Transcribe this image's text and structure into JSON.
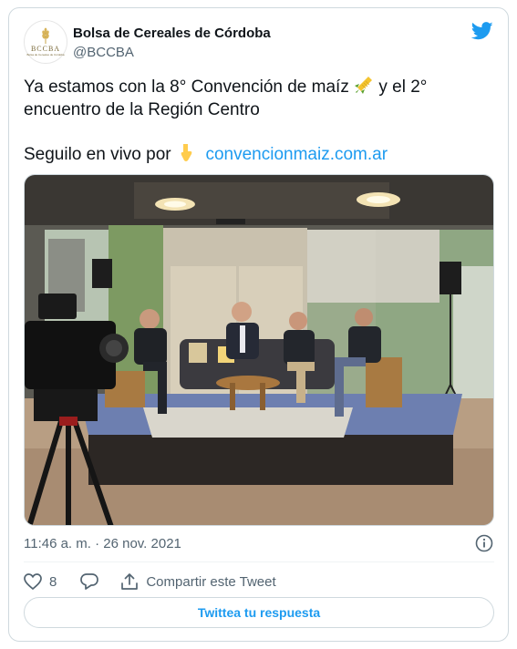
{
  "account": {
    "name": "Bolsa de Cereales de Córdoba",
    "handle": "@BCCBA",
    "avatar_abbr": "BCCBA",
    "avatar_tagline": "Bolsa de Cereales de Córdoba"
  },
  "tweet": {
    "line1_a": "Ya estamos con la 8° Convención de maíz ",
    "line1_b": " y el 2°",
    "line2": "encuentro de la Región Centro",
    "line3": "Seguilo en vivo por ",
    "link": "convencionmaiz.com.ar",
    "emoji_1": "corn-emoji",
    "emoji_2": "pointing-down-emoji"
  },
  "timestamp": "11:46 a. m. · 26 nov. 2021",
  "actions": {
    "like_count": "8",
    "share_label": "Compartir este Tweet"
  },
  "reply_button": "Twittea tu respuesta",
  "colors": {
    "accent": "#1d9bf0",
    "text": "#0f1419",
    "muted": "#536471",
    "border": "#cfd9de"
  }
}
